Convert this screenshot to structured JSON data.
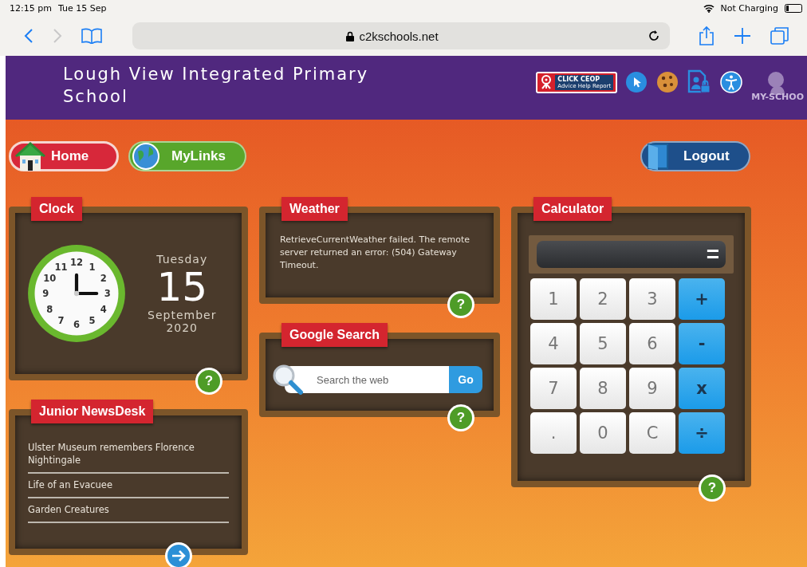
{
  "status_bar": {
    "time": "12:15 pm",
    "date": "Tue 15 Sep",
    "battery_text": "Not Charging"
  },
  "browser": {
    "back_disabled": false,
    "forward_disabled": true,
    "url": "c2kschools.net"
  },
  "header": {
    "title": "Lough View Integrated Primary School",
    "ceop_title": "CLICK CEOP",
    "ceop_subtitle": "Advice Help Report",
    "logo_text": "MY-SCHOO"
  },
  "nav": [
    {
      "label": "Home",
      "kind": "home"
    },
    {
      "label": "MyLinks",
      "kind": "links"
    },
    {
      "label": "Logout",
      "kind": "logout"
    }
  ],
  "clock": {
    "title": "Clock",
    "numerals": [
      "12",
      "11",
      "1",
      "10",
      "2",
      "9",
      "3",
      "8",
      "4",
      "7",
      "5",
      "6"
    ],
    "weekday": "Tuesday",
    "day": "15",
    "month": "September",
    "year": "2020",
    "help": "?"
  },
  "news_desk": {
    "title": "Junior NewsDesk",
    "items": [
      "Ulster Museum remembers Florence Nightingale",
      "Life of an Evacuee",
      "Garden Creatures"
    ]
  },
  "weather": {
    "title": "Weather",
    "message": "RetrieveCurrentWeather failed. The remote server returned an error: (504) Gateway Timeout.",
    "help": "?"
  },
  "google_search": {
    "title": "Google Search",
    "placeholder": "Search the web",
    "button": "Go",
    "help": "?"
  },
  "calculator": {
    "title": "Calculator",
    "equals": "=",
    "help": "?",
    "keys": [
      {
        "label": "1",
        "kind": "digit"
      },
      {
        "label": "2",
        "kind": "digit"
      },
      {
        "label": "3",
        "kind": "digit"
      },
      {
        "label": "+",
        "kind": "operator"
      },
      {
        "label": "4",
        "kind": "digit"
      },
      {
        "label": "5",
        "kind": "digit"
      },
      {
        "label": "6",
        "kind": "digit"
      },
      {
        "label": "-",
        "kind": "operator"
      },
      {
        "label": "7",
        "kind": "digit"
      },
      {
        "label": "8",
        "kind": "digit"
      },
      {
        "label": "9",
        "kind": "digit"
      },
      {
        "label": "x",
        "kind": "operator"
      },
      {
        "label": ".",
        "kind": "digit"
      },
      {
        "label": "0",
        "kind": "digit"
      },
      {
        "label": "C",
        "kind": "digit"
      },
      {
        "label": "÷",
        "kind": "operator"
      }
    ]
  }
}
